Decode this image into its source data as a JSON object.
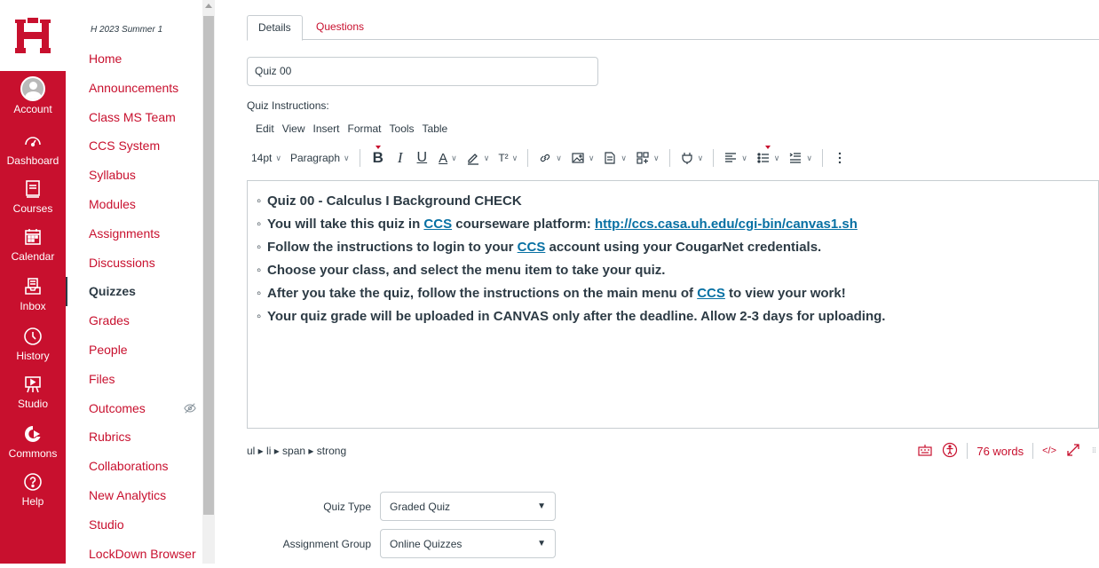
{
  "global_nav": {
    "items": [
      {
        "label": "Account",
        "icon": "account-avatar-icon"
      },
      {
        "label": "Dashboard",
        "icon": "dashboard-icon"
      },
      {
        "label": "Courses",
        "icon": "courses-icon"
      },
      {
        "label": "Calendar",
        "icon": "calendar-icon"
      },
      {
        "label": "Inbox",
        "icon": "inbox-icon"
      },
      {
        "label": "History",
        "icon": "history-icon"
      },
      {
        "label": "Studio",
        "icon": "studio-icon"
      },
      {
        "label": "Commons",
        "icon": "commons-icon"
      },
      {
        "label": "Help",
        "icon": "help-icon"
      }
    ],
    "brand_color": "#c8102e"
  },
  "course_nav": {
    "term": "H 2023 Summer 1",
    "items": [
      {
        "label": "Home"
      },
      {
        "label": "Announcements"
      },
      {
        "label": "Class MS Team"
      },
      {
        "label": "CCS System"
      },
      {
        "label": "Syllabus"
      },
      {
        "label": "Modules"
      },
      {
        "label": "Assignments"
      },
      {
        "label": "Discussions"
      },
      {
        "label": "Quizzes",
        "active": true
      },
      {
        "label": "Grades"
      },
      {
        "label": "People"
      },
      {
        "label": "Files"
      },
      {
        "label": "Outcomes",
        "hidden_icon": "eye-slash-icon"
      },
      {
        "label": "Rubrics"
      },
      {
        "label": "Collaborations"
      },
      {
        "label": "New Analytics"
      },
      {
        "label": "Studio"
      },
      {
        "label": "LockDown Browser"
      }
    ]
  },
  "tabs": {
    "details": "Details",
    "questions": "Questions"
  },
  "quiz": {
    "title_value": "Quiz 00",
    "instructions_label": "Quiz Instructions:"
  },
  "editor_menu": [
    "Edit",
    "View",
    "Insert",
    "Format",
    "Tools",
    "Table"
  ],
  "toolbar": {
    "font_size": "14pt",
    "block_format": "Paragraph",
    "superscript_label": "T²"
  },
  "content": {
    "lines": [
      {
        "parts": [
          {
            "text": "Quiz 00 - Calculus I Background CHECK"
          }
        ]
      },
      {
        "parts": [
          {
            "text": "You will take this quiz in "
          },
          {
            "text": "CCS",
            "link": true
          },
          {
            "text": " courseware platform: "
          },
          {
            "text": "http://ccs.casa.uh.edu/cgi-bin/canvas1.sh",
            "link": true
          }
        ]
      },
      {
        "parts": [
          {
            "text": "Follow the instructions to login to your "
          },
          {
            "text": "CCS",
            "link": true
          },
          {
            "text": " account using your CougarNet credentials."
          }
        ]
      },
      {
        "parts": [
          {
            "text": "Choose your class, and select the menu item to take your quiz."
          }
        ]
      },
      {
        "parts": [
          {
            "text": "After you take the quiz, follow the instructions on the main menu of "
          },
          {
            "text": "CCS",
            "link": true
          },
          {
            "text": " to view your work!"
          }
        ]
      },
      {
        "parts": [
          {
            "text": "Your quiz grade will be uploaded in CANVAS only after the deadline. Allow 2-3 days for uploading."
          }
        ]
      }
    ]
  },
  "statusbar": {
    "path": "ul ▸ li ▸ span ▸ strong",
    "word_count": "76 words",
    "html_toggle": "</>"
  },
  "fields": {
    "quiz_type_label": "Quiz Type",
    "quiz_type_value": "Graded Quiz",
    "assignment_group_label": "Assignment Group",
    "assignment_group_value": "Online Quizzes"
  }
}
